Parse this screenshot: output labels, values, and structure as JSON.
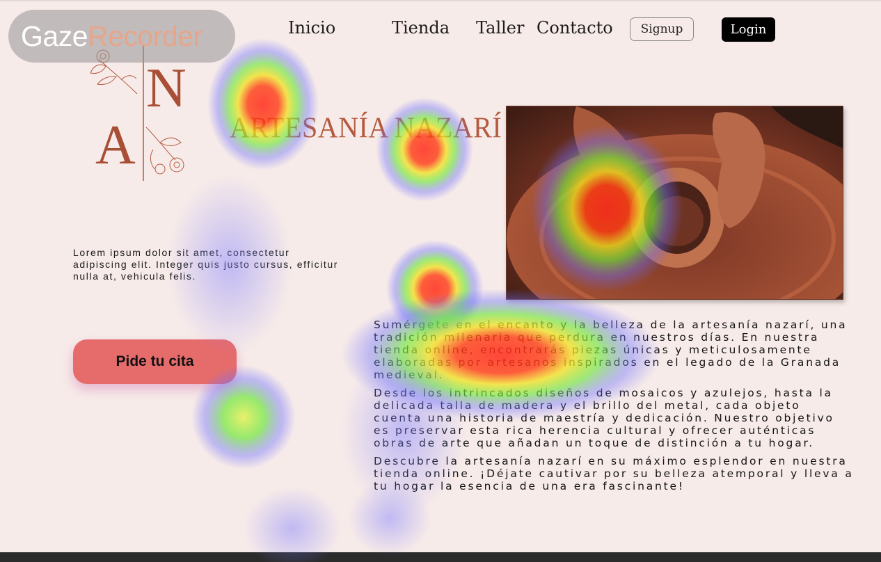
{
  "overlay": {
    "word1": "Gaze",
    "word2": "Recorder"
  },
  "nav": {
    "inicio": "Inicio",
    "tienda": "Tienda",
    "taller": "Taller",
    "contacto": "Contacto",
    "signup": "Signup",
    "login": "Login"
  },
  "logo": {
    "letter_top": "N",
    "letter_bottom": "A"
  },
  "brand": "ARTESANÍA NAZARÍ",
  "intro": "Lorem ipsum dolor sit amet, consectetur adipiscing elit. Integer quis justo cursus, efficitur nulla at, vehicula felis.",
  "cta": "Pide tu cita",
  "paragraphs": [
    "Sumérgete en el encanto y la belleza de la artesanía nazarí, una tradición milenaria que perdura en nuestros días. En nuestra tienda online, encontrarás piezas únicas y meticulosamente elaboradas por artesanos inspirados en el legado de la Granada medieval.",
    "Desde los intrincados diseños de mosaicos y azulejos, hasta la delicada talla de madera y el brillo del metal, cada objeto cuenta una historia de maestría y dedicación. Nuestro objetivo es preservar esta rica herencia cultural y ofrecer auténticas obras de arte que añadan un toque de distinción a tu hogar.",
    "Descubre la artesanía nazarí en su máximo esplendor en nuestra tienda online. ¡Déjate cautivar por su belleza atemporal y lleva a tu hogar la esencia de una era fascinante!"
  ],
  "colors": {
    "background": "#f7ebe9",
    "brand": "#b45b3f",
    "cta": "#e66c6c"
  }
}
